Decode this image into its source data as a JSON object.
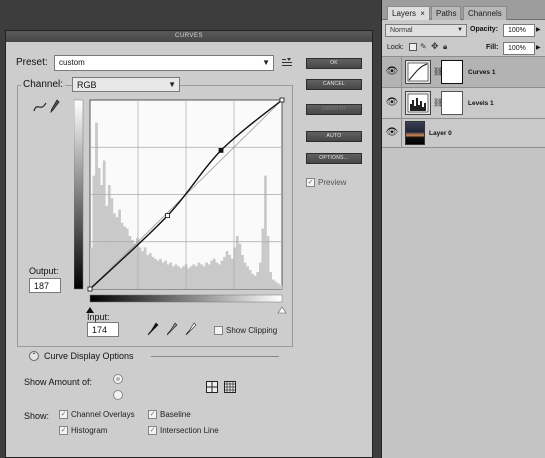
{
  "dialog": {
    "title": "CURVES",
    "preset_label": "Preset:",
    "preset_value": "custom",
    "channel_label": "Channel:",
    "channel_value": "RGB",
    "output_label": "Output:",
    "output_value": "187",
    "input_label": "Input:",
    "input_value": "174",
    "show_clipping_label": "Show Clipping",
    "curve_display_options_label": "Curve Display Options",
    "show_amount_label": "Show Amount of:",
    "show_label": "Show:",
    "checks": {
      "channel_overlays": "Channel Overlays",
      "baseline": "Baseline",
      "histogram": "Histogram",
      "intersection_line": "Intersection Line"
    },
    "buttons": {
      "ok": "OK",
      "cancel": "CANCEL",
      "smooth": "SMOOTH",
      "auto": "AUTO",
      "options": "OPTIONS..."
    },
    "preview_label": "Preview",
    "curve": {
      "baseline_points": [
        [
          0,
          0
        ],
        [
          255,
          255
        ]
      ],
      "control_points": [
        [
          0,
          0
        ],
        [
          103,
          99
        ],
        [
          174,
          187
        ],
        [
          255,
          255
        ]
      ],
      "selected_point": [
        174,
        187
      ],
      "histogram": [
        22,
        60,
        88,
        64,
        55,
        68,
        44,
        55,
        48,
        40,
        38,
        42,
        35,
        33,
        32,
        28,
        26,
        24,
        27,
        22,
        20,
        22,
        18,
        19,
        17,
        16,
        15,
        16,
        14,
        15,
        13,
        14,
        12,
        13,
        12,
        11,
        12,
        13,
        11,
        12,
        13,
        12,
        14,
        13,
        12,
        14,
        13,
        15,
        16,
        14,
        13,
        15,
        17,
        20,
        18,
        16,
        22,
        28,
        24,
        18,
        14,
        12,
        10,
        8,
        7,
        9,
        14,
        32,
        60,
        28,
        9,
        5,
        4,
        3,
        2
      ]
    }
  },
  "layers": {
    "tabs": [
      "Layers",
      "Paths",
      "Channels"
    ],
    "tab_close": "×",
    "blend_mode": "Normal",
    "opacity_label": "Opacity:",
    "opacity_value": "100%",
    "lock_label": "Lock:",
    "fill_label": "Fill:",
    "fill_value": "100%",
    "items": [
      {
        "name": "Curves 1",
        "selected": true
      },
      {
        "name": "Levels 1",
        "selected": false
      },
      {
        "name": "Layer 0",
        "selected": false
      }
    ]
  },
  "colors": {
    "dialog_bg": "#cdcdcd",
    "panel_bg": "#c9c9c9",
    "selected_row": "#b3b3b3",
    "curve": "#111111"
  }
}
